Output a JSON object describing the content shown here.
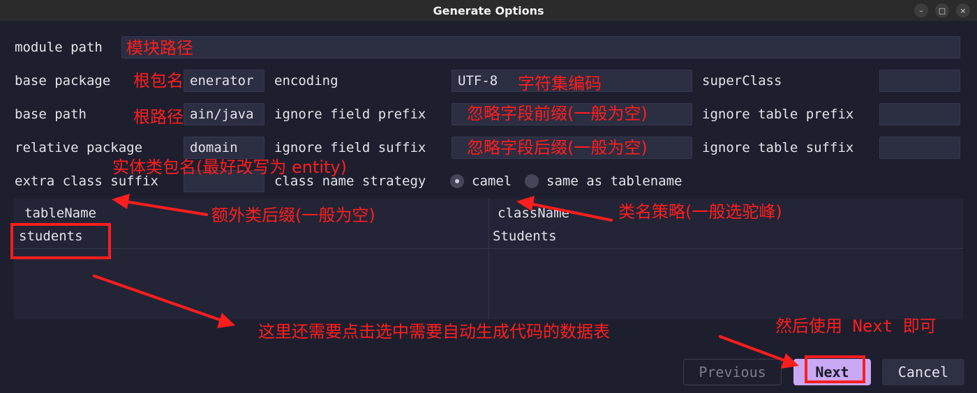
{
  "window": {
    "title": "Generate Options",
    "controls": [
      "–",
      "□",
      "×"
    ]
  },
  "form": {
    "module_path": {
      "label": "module path",
      "value": ""
    },
    "base_package": {
      "label": "base package",
      "value": "enerator"
    },
    "base_path": {
      "label": "base path",
      "value": "ain/java"
    },
    "relative_package": {
      "label": "relative package",
      "value": "domain"
    },
    "extra_class_suffix": {
      "label": "extra class suffix",
      "value": ""
    },
    "encoding": {
      "label": "encoding",
      "value": "UTF-8"
    },
    "ignore_field_prefix": {
      "label": "ignore field prefix",
      "value": ""
    },
    "ignore_field_suffix": {
      "label": "ignore field suffix",
      "value": ""
    },
    "super_class": {
      "label": "superClass",
      "value": ""
    },
    "ignore_table_prefix": {
      "label": "ignore table prefix",
      "value": ""
    },
    "ignore_table_suffix": {
      "label": "ignore table suffix",
      "value": ""
    },
    "class_name_strategy": {
      "label": "class name strategy",
      "options": [
        "camel",
        "same as tablename"
      ],
      "selected": "camel"
    }
  },
  "table": {
    "columns": [
      "tableName",
      "className"
    ],
    "rows": [
      [
        "students",
        "Students"
      ]
    ]
  },
  "buttons": {
    "previous": "Previous",
    "next": "Next",
    "cancel": "Cancel"
  },
  "annotations": {
    "module_path": "模块路径",
    "base_package": "根包名",
    "base_path": "根路径",
    "relative_package": "实体类包名(最好改写为 entity)",
    "encoding": "字符集编码",
    "ignore_field_prefix": "忽略字段前缀(一般为空)",
    "ignore_field_suffix": "忽略字段后缀(一般为空)",
    "extra_class_suffix": "额外类后缀(一般为空)",
    "class_name_strategy": "类名策略(一般选驼峰)",
    "select_table": "这里还需要点击选中需要自动生成代码的数据表",
    "next": "然后使用 Next 即可"
  },
  "colors": {
    "background": "#1e1f2e",
    "field": "#2c2e42",
    "annotation": "#ff1e1e",
    "next_button": "#c9a8f5"
  }
}
